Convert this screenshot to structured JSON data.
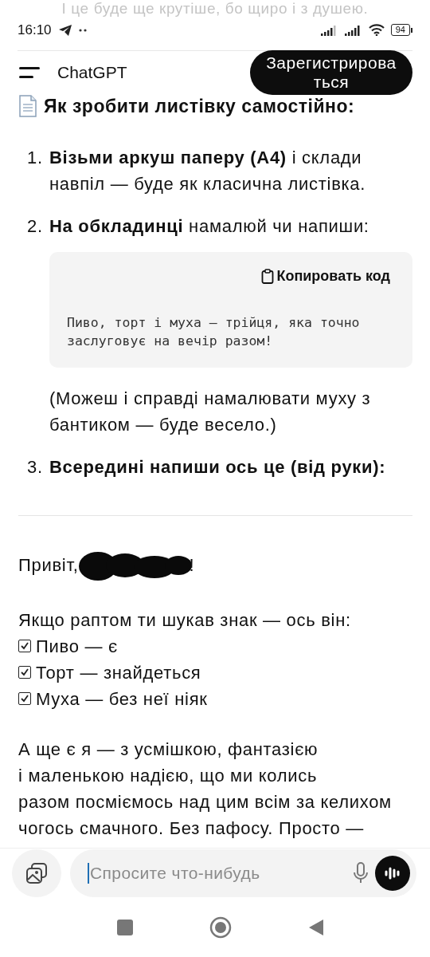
{
  "top_cut_text": "І це буде ще крутіше, бо щиро і з душею.",
  "status_bar": {
    "time": "16:10",
    "battery": "94"
  },
  "header": {
    "title": "ChatGPT",
    "signup_button": "Зарегистрироваться"
  },
  "content": {
    "heading": "Як зробити листівку самостійно:",
    "steps": [
      {
        "number": "1.",
        "kind": "text",
        "text": "**Візьми аркуш паперу (А4)** і склади навпіл — буде як класична листівка."
      },
      {
        "number": "2.",
        "kind": "code",
        "text": "**На обкладинці** намалюй чи напиши:",
        "copy_button": "Копировать код",
        "code": "Пиво, торт і муха — трійця, яка точно\nзаслуговує на вечір разом!",
        "note": "(Можеш і справді намалювати муху з бантиком — буде весело.)"
      },
      {
        "number": "3.",
        "kind": "bold_text",
        "text": "Всередині напиши ось це (від руки):"
      }
    ],
    "letter": {
      "greeting": "Привіт,",
      "redacted": true,
      "greeting_end": "!",
      "intro": "Якщо раптом ти шукав знак — ось він:",
      "checklist": [
        {
          "text": "Пиво — є",
          "checked": true
        },
        {
          "text": "Торт — знайдеться",
          "checked": true
        },
        {
          "text": "Муха — без неї ніяк",
          "checked": true
        }
      ],
      "paragraph": "А ще є я — з усмішкою, фантазією\nі маленькою надією, що ми колись\nразом посміємось над цим всім за келихом\nчогось смачного. Без пафосу. Просто —"
    }
  },
  "composer": {
    "placeholder": "Спросите что-нибудь"
  }
}
